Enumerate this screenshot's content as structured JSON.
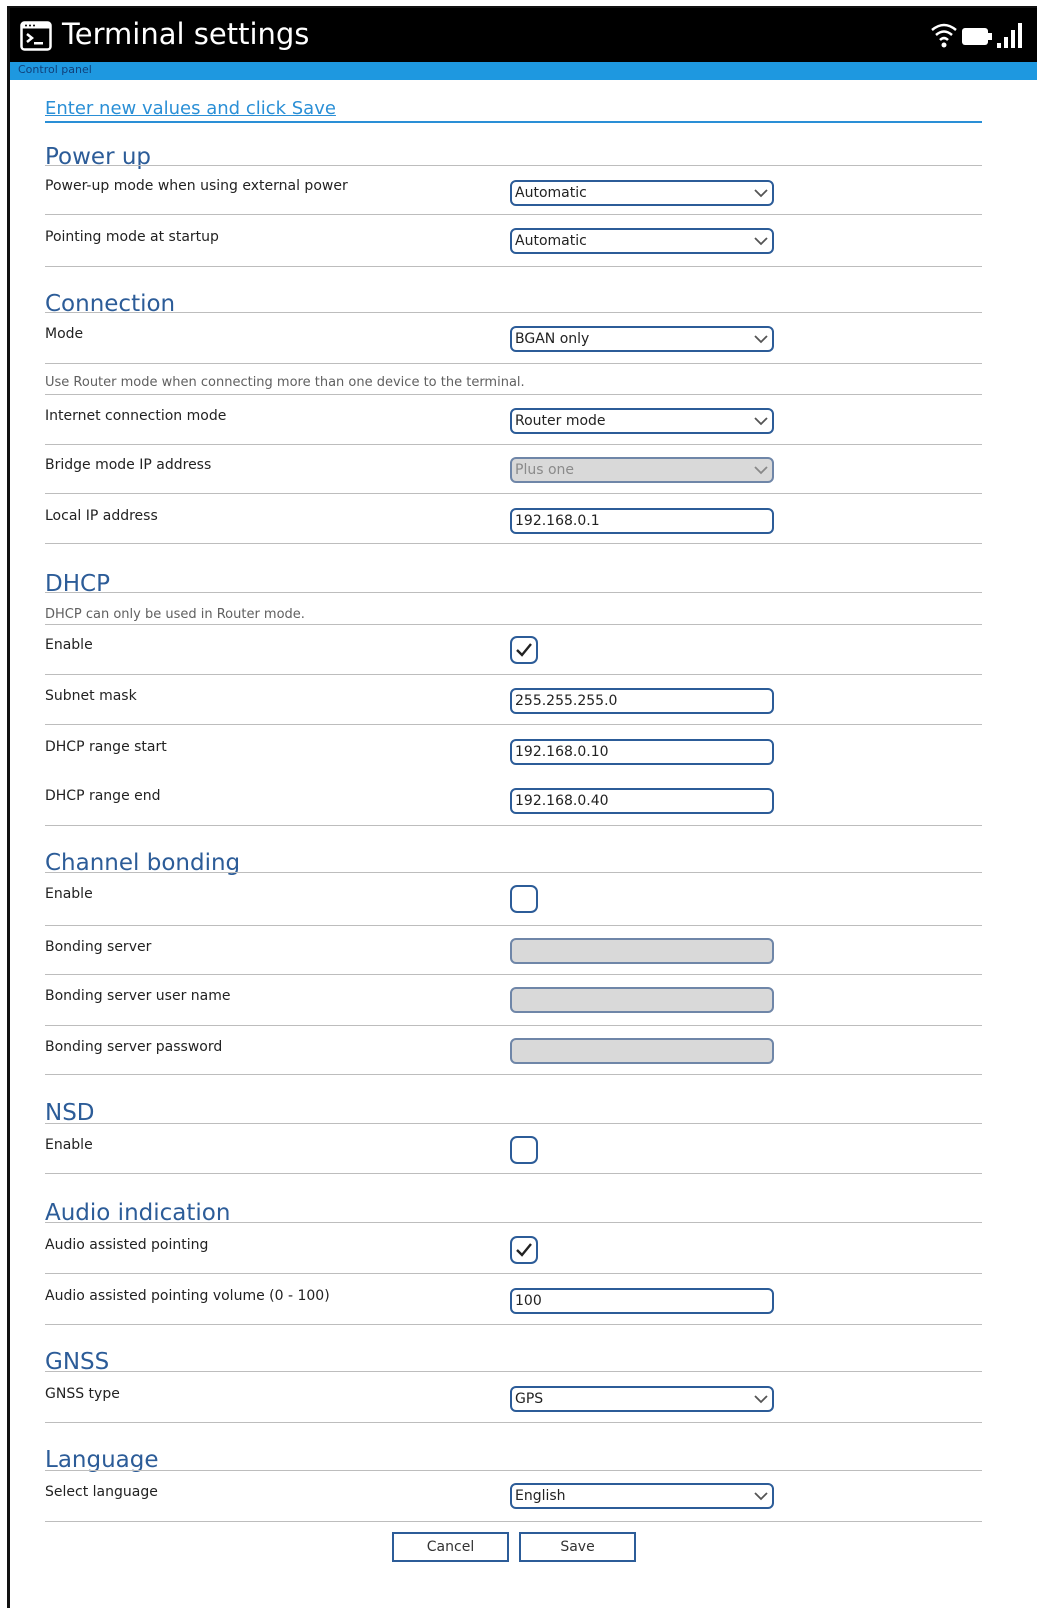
{
  "header": {
    "title": "Terminal settings",
    "breadcrumb": "Control panel",
    "app_icon": "terminal-icon",
    "status_icons": [
      "wifi-icon",
      "battery-icon",
      "signal-icon"
    ]
  },
  "instruction": "Enter new values and click Save",
  "sections": {
    "power_up": {
      "title": "Power up",
      "power_mode_label": "Power-up mode when using external power",
      "power_mode_value": "Automatic",
      "pointing_label": "Pointing mode at startup",
      "pointing_value": "Automatic"
    },
    "connection": {
      "title": "Connection",
      "mode_label": "Mode",
      "mode_value": "BGAN only",
      "note": "Use Router mode when connecting more than one device to the terminal.",
      "internet_label": "Internet connection mode",
      "internet_value": "Router mode",
      "bridge_label": "Bridge mode IP address",
      "bridge_value": "Plus one",
      "local_ip_label": "Local IP address",
      "local_ip_value": "192.168.0.1"
    },
    "dhcp": {
      "title": "DHCP",
      "note": "DHCP can only be used in Router mode.",
      "enable_label": "Enable",
      "enabled": true,
      "subnet_label": "Subnet mask",
      "subnet_value": "255.255.255.0",
      "start_label": "DHCP range start",
      "start_value": "192.168.0.10",
      "end_label": "DHCP range end",
      "end_value": "192.168.0.40"
    },
    "channel_bonding": {
      "title": "Channel bonding",
      "enable_label": "Enable",
      "enabled": false,
      "server_label": "Bonding server",
      "user_label": "Bonding server user name",
      "password_label": "Bonding server password"
    },
    "nsd": {
      "title": "NSD",
      "enable_label": "Enable",
      "enabled": false
    },
    "audio": {
      "title": "Audio indication",
      "assisted_label": "Audio assisted pointing",
      "assisted_enabled": true,
      "volume_label": "Audio assisted pointing volume (0 - 100)",
      "volume_value": "100"
    },
    "gnss": {
      "title": "GNSS",
      "type_label": "GNSS type",
      "type_value": "GPS"
    },
    "language": {
      "title": "Language",
      "select_label": "Select language",
      "select_value": "English"
    }
  },
  "buttons": {
    "cancel": "Cancel",
    "save": "Save"
  },
  "colors": {
    "header_bg": "#000000",
    "accent": "#1e98e0",
    "section_title": "#2c5c98",
    "control_border": "#2c5c98",
    "disabled_bg": "#d9d9d9"
  }
}
